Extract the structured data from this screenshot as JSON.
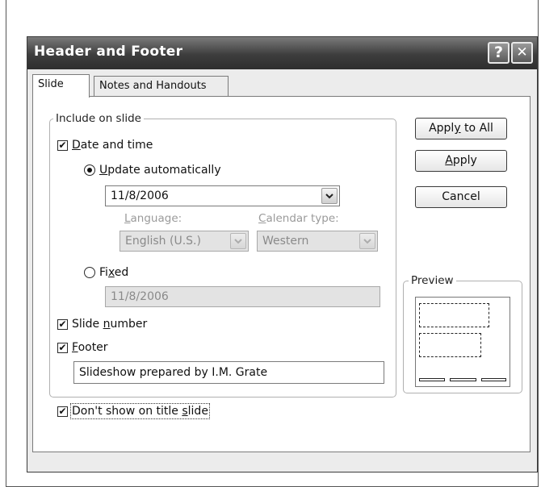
{
  "dialog": {
    "title": "Header and Footer",
    "help_glyph": "?",
    "close_glyph": "✕"
  },
  "tabs": [
    {
      "label": "Slide",
      "active": true
    },
    {
      "label": "Notes and Handouts",
      "active": false
    }
  ],
  "include_group": {
    "legend": "Include on slide"
  },
  "date_time": {
    "checked": true,
    "label_pre": "",
    "label_ul": "D",
    "label_post": "ate and time",
    "update_auto": {
      "selected": true,
      "label_ul": "U",
      "label_post": "pdate automatically",
      "value": "11/8/2006"
    },
    "language": {
      "label_ul": "L",
      "label_post": "anguage:",
      "value": "English (U.S.)"
    },
    "calendar": {
      "label_ul": "C",
      "label_post": "alendar type:",
      "value": "Western"
    },
    "fixed": {
      "selected": false,
      "label_pre": "Fi",
      "label_ul": "x",
      "label_post": "ed",
      "value": "11/8/2006"
    }
  },
  "slide_number": {
    "checked": true,
    "label_pre": "Slide ",
    "label_ul": "n",
    "label_post": "umber"
  },
  "footer": {
    "checked": true,
    "label_ul": "F",
    "label_post": "ooter",
    "value": "Slideshow prepared by I.M. Grate"
  },
  "dont_show": {
    "checked": true,
    "label_pre": "Don't show on title ",
    "label_ul": "s",
    "label_post": "lide"
  },
  "buttons": {
    "apply_all": {
      "pre": "Appl",
      "ul": "y",
      "post": " to All"
    },
    "apply": {
      "pre": "",
      "ul": "A",
      "post": "pply"
    },
    "cancel": {
      "label": "Cancel"
    }
  },
  "preview": {
    "legend": "Preview"
  }
}
